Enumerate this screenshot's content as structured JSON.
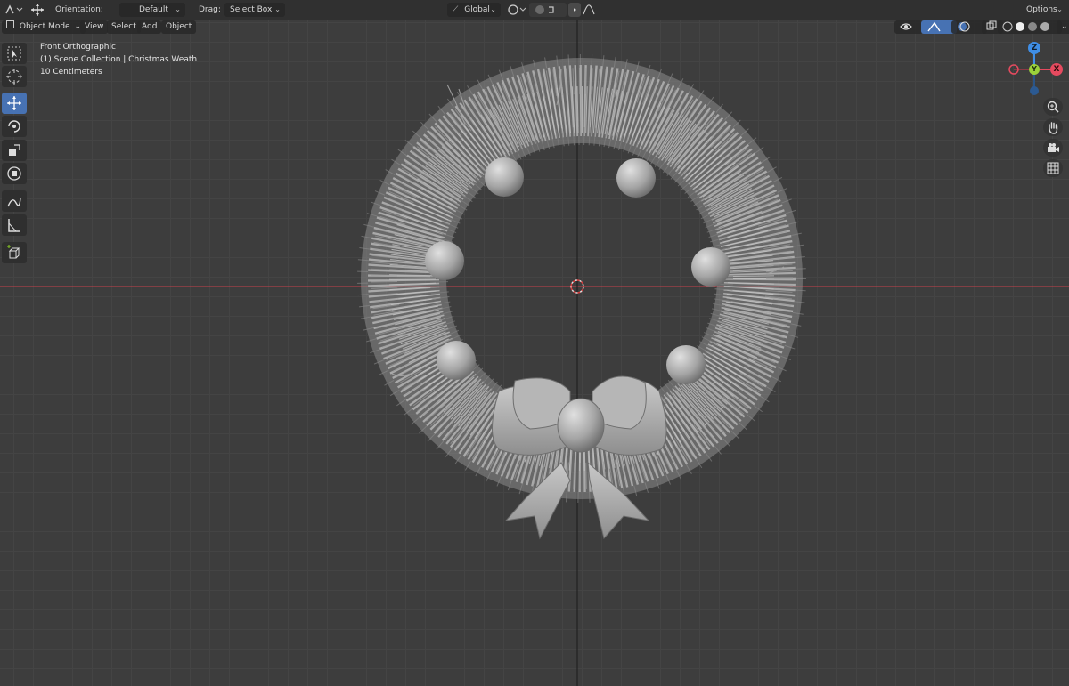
{
  "header": {
    "orientation_label": "Orientation:",
    "orientation_value": "Default",
    "drag_label": "Drag:",
    "drag_value": "Select Box",
    "transform_orientation": "Global",
    "options_label": "Options"
  },
  "view_header": {
    "mode": "Object Mode",
    "menus": [
      "View",
      "Select",
      "Add",
      "Object"
    ]
  },
  "overlay": {
    "view_name": "Front Orthographic",
    "collection": "(1) Scene Collection | Christmas Weath",
    "scale": "10 Centimeters"
  },
  "gizmo": {
    "x_label": "X",
    "y_label": "Y",
    "z_label": "Z",
    "x_color": "#e64a5f",
    "y_color": "#7bb326",
    "z_color": "#3f8ee6"
  },
  "toolbar": {
    "tools": [
      "select-box-icon",
      "cursor-icon",
      "move-icon",
      "rotate-icon",
      "scale-icon",
      "transform-icon",
      "annotate-icon",
      "measure-icon",
      "add-cube-icon"
    ],
    "active_tool": "move-icon"
  },
  "colors": {
    "viewport_bg": "#3d3d3d",
    "x_axis": "#c8414b",
    "active_tool": "#4772b3"
  }
}
